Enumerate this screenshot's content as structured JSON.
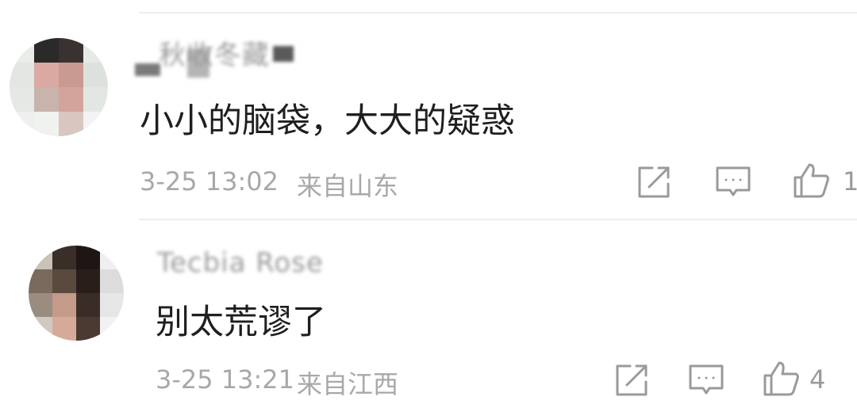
{
  "comments": [
    {
      "username": "秋收冬藏",
      "text": "小小的脑袋，大大的疑惑",
      "time": "3-25 13:02",
      "location": "来自山东",
      "likes": "1",
      "share_icon": "share-external-icon",
      "reply_icon": "comment-bubble-icon",
      "like_icon": "thumbs-up-icon"
    },
    {
      "username": "Tecbia Rose",
      "text": "别太荒谬了",
      "time": "3-25 13:21",
      "location": "来自江西",
      "likes": "4",
      "share_icon": "share-external-icon",
      "reply_icon": "comment-bubble-icon",
      "like_icon": "thumbs-up-icon"
    }
  ],
  "colors": {
    "meta_text": "#a8a8a8",
    "body_text": "#1f1f1f",
    "icon": "#9a9a9a",
    "divider": "#eeeeee"
  }
}
